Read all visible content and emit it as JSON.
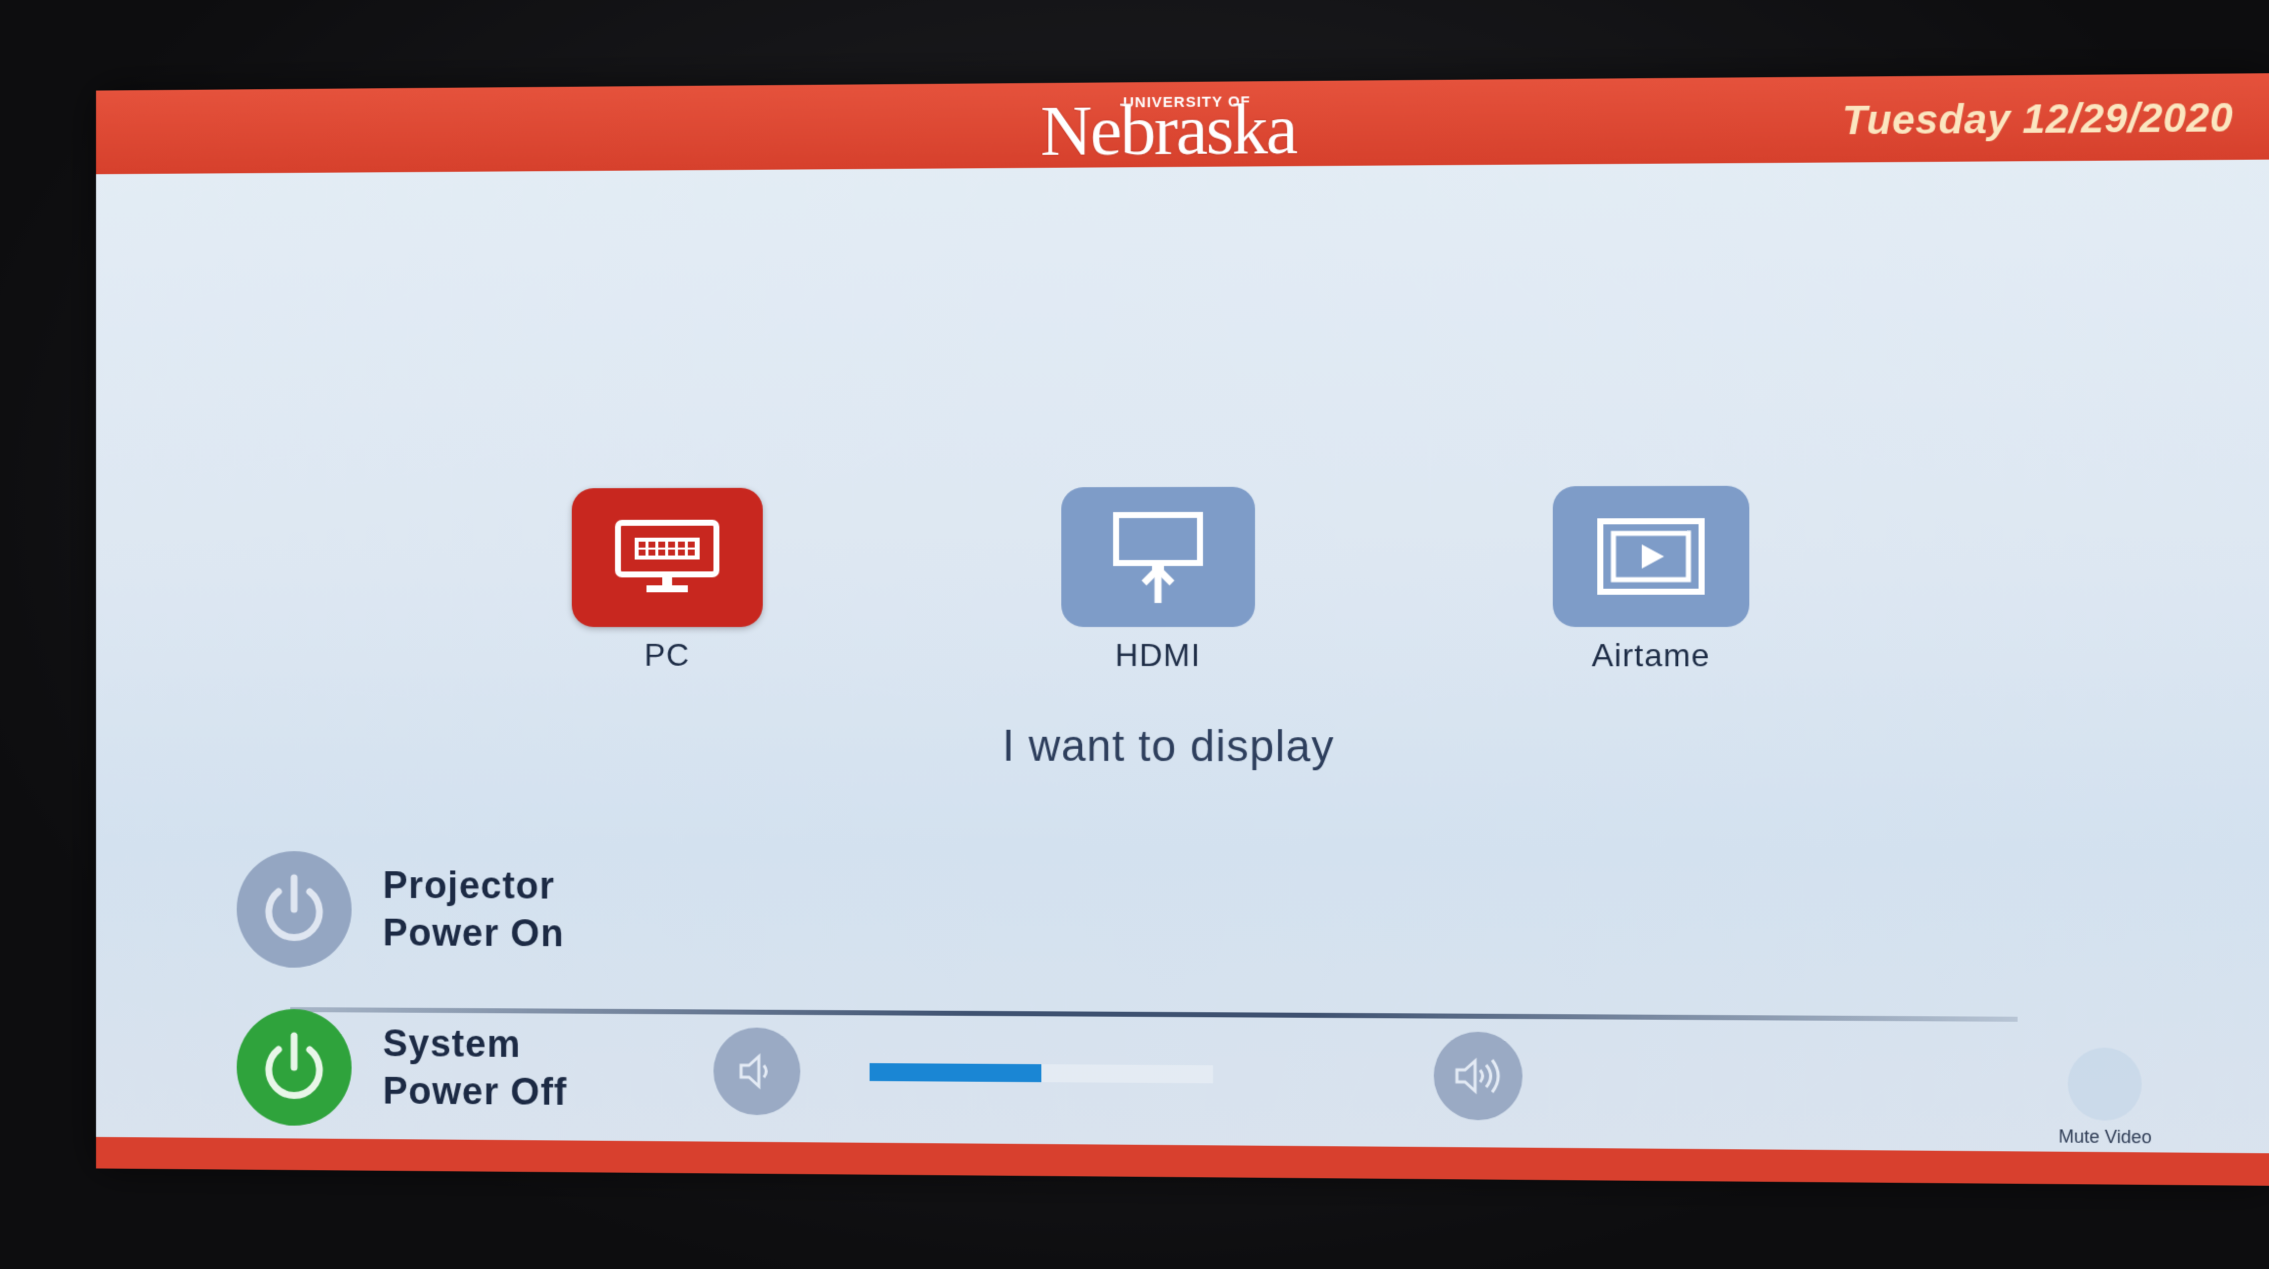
{
  "header": {
    "logo_small": "UNIVERSITY OF",
    "logo_main": "Nebraska",
    "date": "Tuesday 12/29/2020"
  },
  "sources": [
    {
      "label": "PC",
      "state": "active",
      "icon": "desktop-keyboard-icon"
    },
    {
      "label": "HDMI",
      "state": "inactive",
      "icon": "hdmi-input-icon"
    },
    {
      "label": "Airtame",
      "state": "inactive",
      "icon": "airtame-play-icon"
    }
  ],
  "prompt": "I want to display",
  "projector": {
    "line1": "Projector",
    "line2": "Power On",
    "icon": "power-icon"
  },
  "system": {
    "line1": "System",
    "line2": "Power Off",
    "icon": "power-icon"
  },
  "volume": {
    "level": 0.5,
    "down_icon": "volume-down-icon",
    "up_icon": "volume-up-icon"
  },
  "mute_video": {
    "label": "Mute Video"
  },
  "colors": {
    "header": "#e5523c",
    "date_text": "#fbe6c0",
    "pc_active": "#c8271f",
    "inactive_tile": "#7e9cc8",
    "system_power": "#2fa33c",
    "volume_fill": "#1a86d4"
  }
}
